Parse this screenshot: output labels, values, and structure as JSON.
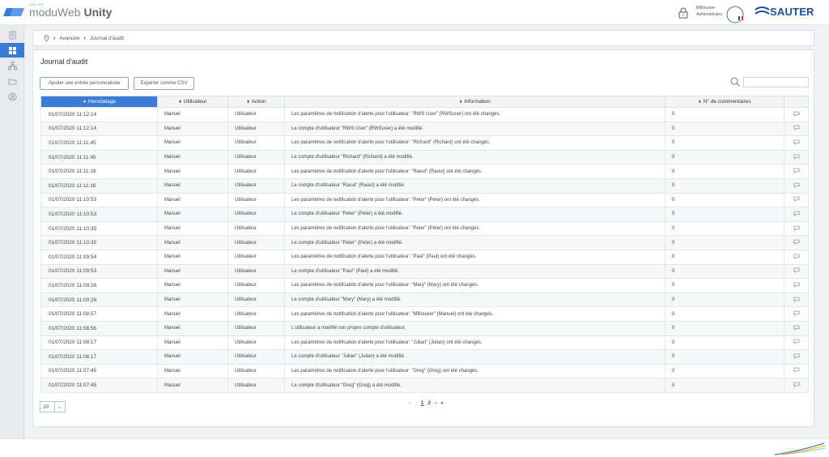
{
  "header": {
    "brand_small": "SAUTER",
    "brand_prefix": "moduWeb ",
    "brand_bold": "Unity",
    "user_name": "MBouvier",
    "user_role": "Administrator",
    "company": "SAUTER",
    "colors": {
      "accent": "#3a7bd5",
      "brand": "#1b4f9c"
    }
  },
  "sidebar": {
    "items": [
      {
        "icon": "building-icon",
        "active": false
      },
      {
        "icon": "dashboard-icon",
        "active": true
      },
      {
        "icon": "hierarchy-icon",
        "active": false
      },
      {
        "icon": "folder-icon",
        "active": false
      },
      {
        "icon": "user-circle-icon",
        "active": false
      }
    ]
  },
  "breadcrumb": {
    "icon": "location-icon",
    "items": [
      "Avancée",
      "Journal d'audit"
    ]
  },
  "page": {
    "title": "Journal d'audit",
    "add_button": "Ajouter une entrée personnalisée",
    "export_button": "Exporter comme CSV",
    "search_placeholder": ""
  },
  "table": {
    "columns": [
      "Horodatage",
      "Utilisateur",
      "Action",
      "Information",
      "N° de commentaires",
      ""
    ],
    "sorted_column": "Horodatage",
    "rows": [
      [
        "01/07/2020 11:12:14",
        "Manuel",
        "Utilisateur",
        "Les paramètres de notification d'alerte pour l'utilisateur: \"RWS User\" (RWSuser) ont été changés.",
        "0"
      ],
      [
        "01/07/2020 11:12:14",
        "Manuel",
        "Utilisateur",
        "Le compte d'utilisateur \"RWS User\" (RWSuser) a été modifié.",
        "0"
      ],
      [
        "01/07/2020 11:11:45",
        "Manuel",
        "Utilisateur",
        "Les paramètres de notification d'alerte pour l'utilisateur: \"Richard\" (Richard) ont été changés.",
        "0"
      ],
      [
        "01/07/2020 11:11:45",
        "Manuel",
        "Utilisateur",
        "Le compte d'utilisateur \"Richard\" (Richard) a été modifié.",
        "0"
      ],
      [
        "01/07/2020 11:11:16",
        "Manuel",
        "Utilisateur",
        "Les paramètres de notification d'alerte pour l'utilisateur: \"Raoul\" (Raoul) ont été changés.",
        "0"
      ],
      [
        "01/07/2020 11:11:16",
        "Manuel",
        "Utilisateur",
        "Le compte d'utilisateur \"Raoul\" (Raoul) a été modifié.",
        "0"
      ],
      [
        "01/07/2020 11:10:53",
        "Manuel",
        "Utilisateur",
        "Les paramètres de notification d'alerte pour l'utilisateur: \"Peter\" (Peter) ont été changés.",
        "0"
      ],
      [
        "01/07/2020 11:10:53",
        "Manuel",
        "Utilisateur",
        "Le compte d'utilisateur \"Peter\" (Peter) a été modifié.",
        "0"
      ],
      [
        "01/07/2020 11:10:35",
        "Manuel",
        "Utilisateur",
        "Les paramètres de notification d'alerte pour l'utilisateur: \"Peter\" (Peter) ont été changés.",
        "0"
      ],
      [
        "01/07/2020 11:10:35",
        "Manuel",
        "Utilisateur",
        "Le compte d'utilisateur \"Peter\" (Peter) a été modifié.",
        "0"
      ],
      [
        "01/07/2020 11:09:54",
        "Manuel",
        "Utilisateur",
        "Les paramètres de notification d'alerte pour l'utilisateur: \"Paul\" (Paul) ont été changés.",
        "0"
      ],
      [
        "01/07/2020 11:09:53",
        "Manuel",
        "Utilisateur",
        "Le compte d'utilisateur \"Paul\" (Paul) a été modifié.",
        "0"
      ],
      [
        "01/07/2020 11:09:26",
        "Manuel",
        "Utilisateur",
        "Les paramètres de notification d'alerte pour l'utilisateur: \"Mary\" (Mary) ont été changés.",
        "0"
      ],
      [
        "01/07/2020 11:09:26",
        "Manuel",
        "Utilisateur",
        "Le compte d'utilisateur \"Mary\" (Mary) a été modifié.",
        "0"
      ],
      [
        "01/07/2020 11:08:57",
        "Manuel",
        "Utilisateur",
        "Les paramètres de notification d'alerte pour l'utilisateur: \"MBouvier\" (Manuel) ont été changés.",
        "0"
      ],
      [
        "01/07/2020 11:08:56",
        "Manuel",
        "Utilisateur",
        "L'utilisateur a modifié son propre compte d'utilisateur.",
        "0"
      ],
      [
        "01/07/2020 11:08:17",
        "Manuel",
        "Utilisateur",
        "Les paramètres de notification d'alerte pour l'utilisateur: \"Julian\" (Julian) ont été changés.",
        "0"
      ],
      [
        "01/07/2020 11:08:17",
        "Manuel",
        "Utilisateur",
        "Le compte d'utilisateur \"Julian\" (Julian) a été modifié.",
        "0"
      ],
      [
        "01/07/2020 11:07:45",
        "Manuel",
        "Utilisateur",
        "Les paramètres de notification d'alerte pour l'utilisateur: \"Greg\" (Greg) ont été changés.",
        "0"
      ],
      [
        "01/07/2020 11:07:45",
        "Manuel",
        "Utilisateur",
        "Le compte d'utilisateur \"Greg\" (Greg) a été modifié.",
        "0"
      ]
    ]
  },
  "pagination": {
    "page_size": "20",
    "first": "«",
    "prev": "‹",
    "pages": [
      "1",
      "2"
    ],
    "current_page": "1",
    "next": "›",
    "last": "»"
  }
}
